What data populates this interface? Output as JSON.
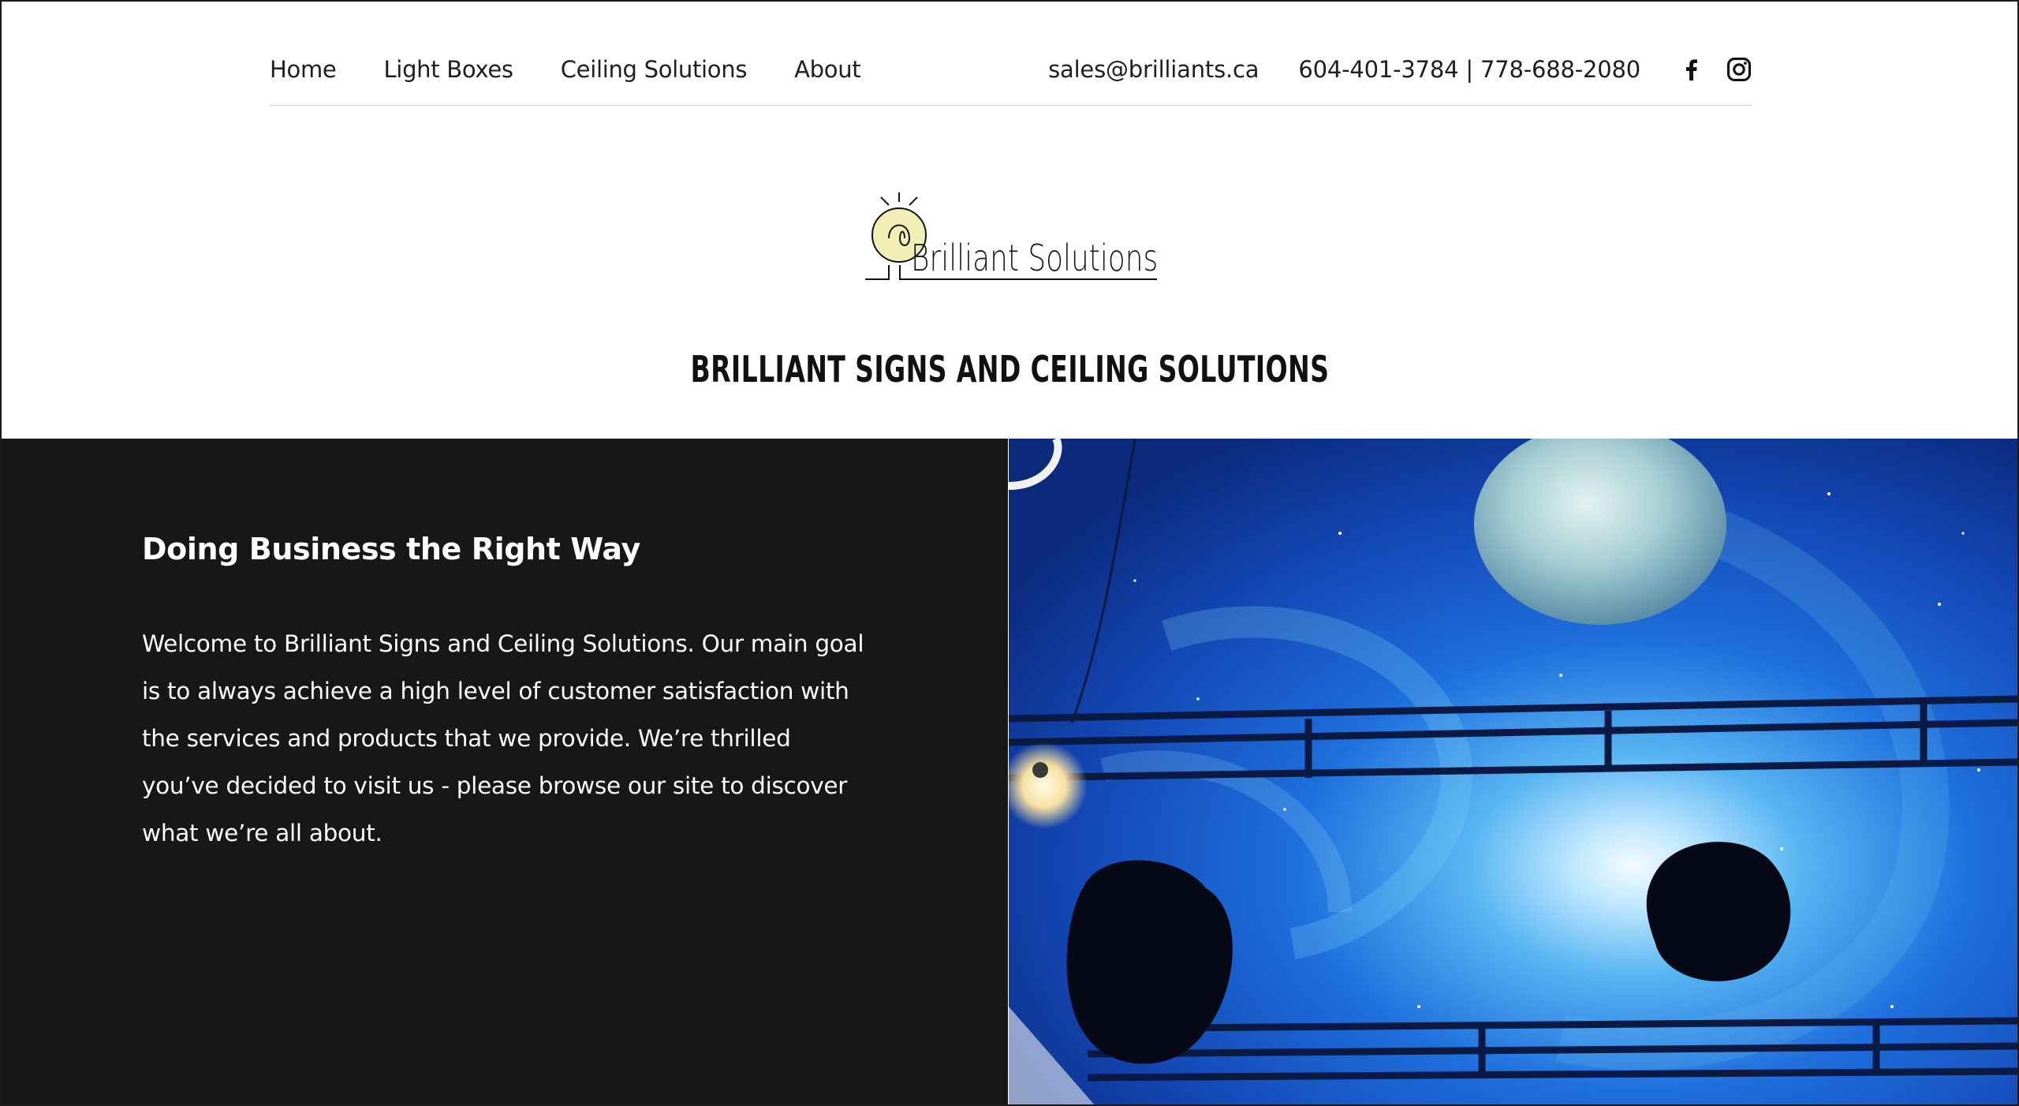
{
  "nav": {
    "items": [
      {
        "label": "Home"
      },
      {
        "label": "Light Boxes"
      },
      {
        "label": "Ceiling Solutions"
      },
      {
        "label": "About"
      }
    ],
    "email": "sales@brilliants.ca",
    "phone": "604-401-3784 | 778-688-2080",
    "social": [
      {
        "icon": "facebook-icon"
      },
      {
        "icon": "instagram-icon"
      }
    ]
  },
  "logo": {
    "text": "Brilliant Solutions"
  },
  "site_title": "BRILLIANT SIGNS AND CEILING SOLUTIONS",
  "hero": {
    "heading": "Doing Business the Right Way",
    "paragraph": "Welcome to Brilliant Signs and Ceiling Solutions. Our main goal is to always achieve a high level of customer satisfaction with the services and products that we provide. We’re thrilled you’ve decided to visit us - please browse our site to discover what we’re all about."
  },
  "colors": {
    "hero_dark": "#171718",
    "logo_bulb": "#f3efb4",
    "sky_blue": "#1c5ac8"
  }
}
